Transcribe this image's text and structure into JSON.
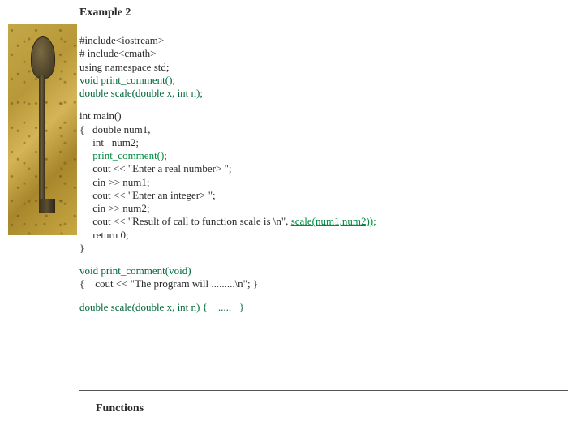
{
  "title": "Example 2",
  "code": {
    "block1": {
      "l1": "#include<iostream>",
      "l2": "# include<cmath>",
      "l3": "using namespace std;",
      "l4": "void print_comment();",
      "l5": "double scale(double x, int n);"
    },
    "block2": {
      "l1": "int main()",
      "l2": "{   double num1,",
      "l3": "     int   num2;",
      "l4": "     print_comment();",
      "l5": "     cout << \"Enter a real number> \";",
      "l6": "     cin >> num1;",
      "l7": "     cout << \"Enter an integer> \";",
      "l8": "     cin >> num2;",
      "l9a": "     cout << \"Result of call to function scale is \\n\", ",
      "l9b": "scale(num1,num2));",
      "l10": "     return 0;",
      "l11": "}"
    },
    "block3": {
      "l1": "void print_comment(void)",
      "l2": "{    cout << \"The program will .........\\n\"; }"
    },
    "block4": {
      "l1": "double scale(double x, int n) {    .....   }"
    }
  },
  "footer": "Functions"
}
